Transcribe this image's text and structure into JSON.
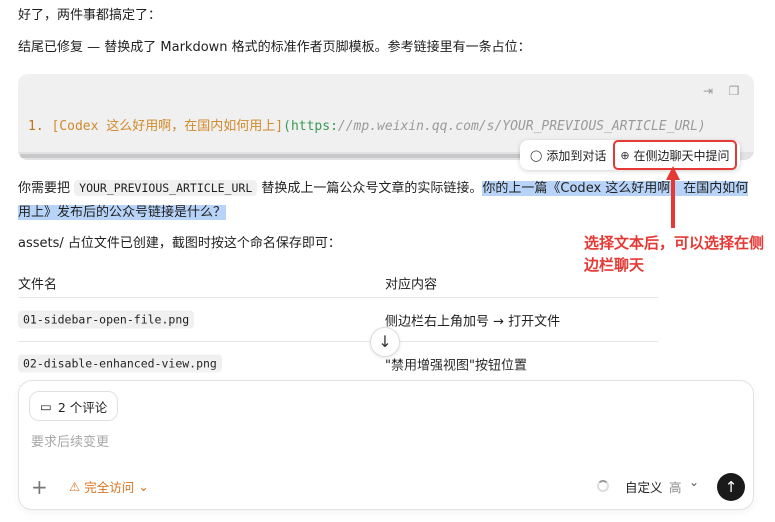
{
  "intro": "好了，两件事都搞定了：",
  "summary": "结尾已修复 — 替换成了 Markdown 格式的标准作者页脚模板。参考链接里有一条占位：",
  "code": {
    "number": "1.",
    "link_text": "[Codex 这么好用啊，在国内如何用上]",
    "paren_open": "(",
    "scheme": "https:",
    "path": "//mp.weixin.qq.com/s/YOUR_PREVIOUS_ARTICLE_URL)"
  },
  "popup": {
    "add_label": "添加到对话",
    "ask_label": "在侧边聊天中提问"
  },
  "instruction": {
    "prefix": "你需要把",
    "placeholder": "YOUR_PREVIOUS_ARTICLE_URL",
    "middle": "替换成上一篇公众号文章的实际链接。",
    "selected": "你的上一篇《Codex 这么好用啊，在国内如何用上》发布后的公众号链接是什么？"
  },
  "assets_note": "assets/ 占位文件已创建，截图时按这个命名保存即可：",
  "table": {
    "headers": [
      "文件名",
      "对应内容"
    ],
    "rows": [
      [
        "01-sidebar-open-file.png",
        "侧边栏右上角加号 → 打开文件"
      ],
      [
        "02-disable-enhanced-view.png",
        "\"禁用增强视图\"按钮位置"
      ]
    ]
  },
  "annotation": "选择文本后，可以选择在侧边栏聊天",
  "composer": {
    "comments": "2 个评论",
    "placeholder": "要求后续变更",
    "access": "完全访问",
    "model": "自定义",
    "effort": "高"
  },
  "colors": {
    "selection": "#b7d4f8",
    "annotation": "#e53935",
    "access": "#d9731d"
  }
}
